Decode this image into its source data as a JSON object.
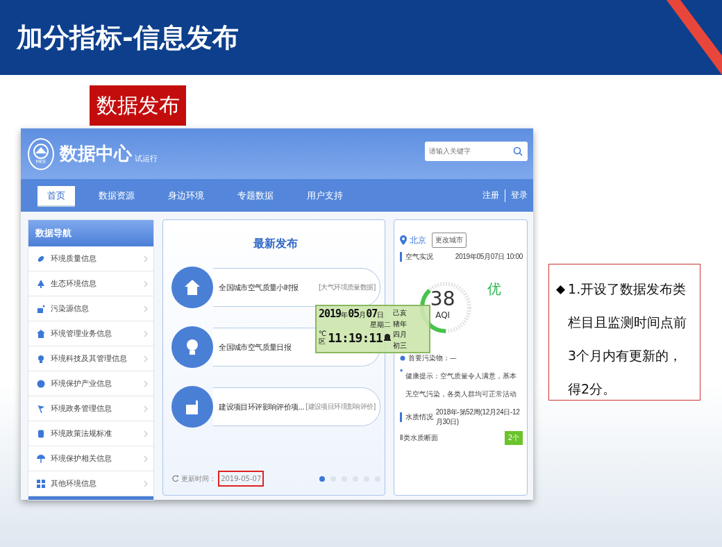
{
  "slide": {
    "title": "加分指标-信息发布",
    "section_label": "数据发布"
  },
  "site": {
    "logo_title": "数据中心",
    "logo_badge": "试运行",
    "logo_text": "MEE",
    "search": {
      "placeholder": "请输入关键字"
    },
    "nav": [
      {
        "label": "首页",
        "selected": true
      },
      {
        "label": "数据资源",
        "selected": false
      },
      {
        "label": "身边环境",
        "selected": false
      },
      {
        "label": "专题数据",
        "selected": false
      },
      {
        "label": "用户支持",
        "selected": false
      }
    ],
    "auth_links": [
      "注册",
      "登录"
    ]
  },
  "sidebar": {
    "title": "数据导航",
    "items": [
      {
        "label": "环境质量信息"
      },
      {
        "label": "生态环境信息"
      },
      {
        "label": "污染源信息"
      },
      {
        "label": "环境管理业务信息"
      },
      {
        "label": "环境科技及其管理信息"
      },
      {
        "label": "环境保护产业信息"
      },
      {
        "label": "环境政务管理信息"
      },
      {
        "label": "环境政策法规标准"
      },
      {
        "label": "环境保护相关信息"
      },
      {
        "label": "其他环境信息"
      }
    ]
  },
  "latest": {
    "title": "最新发布",
    "items": [
      {
        "title": "全国城市空气质量小时报",
        "tag": "[大气环境质量数据]"
      },
      {
        "title": "全国城市空气质量日报"
      },
      {
        "title": "建设项目环评影响评价项...",
        "tag": "[建设项目环境影响评价]"
      }
    ],
    "update_label": "更新时间：",
    "update_date": "2019-05-07",
    "update_highlighted": true,
    "pager": [
      {
        "selected": true
      },
      {
        "selected": false
      },
      {
        "selected": false
      },
      {
        "selected": false
      },
      {
        "selected": false
      },
      {
        "selected": false
      }
    ]
  },
  "air": {
    "city": "北京",
    "change_city": "更改城市",
    "section": "空气实况",
    "datetime": "2019年05月07日 10:00",
    "aqi": "38",
    "aqi_label": "AQI",
    "grade": "优",
    "level": 0.38,
    "pollutant": "首要污染物：—",
    "health": "健康提示：空气质量令人满意，基本无空气污染，各类人群均可正常活动",
    "water_section": "水质情况",
    "water_period": "2018年-第52周(12月24日-12月30日)",
    "water_item": "Ⅱ类水质断面",
    "water_count": "2个"
  },
  "clock": {
    "year": "2019",
    "year_unit": "年",
    "month": "05",
    "month_unit": "月",
    "day": "07",
    "day_unit": "日",
    "weekday": "星期二",
    "time": "11:19:11",
    "temp_unit": "℃",
    "zone": "区",
    "lunar": [
      "己亥",
      "猪年",
      "四月",
      "初三"
    ]
  },
  "callout": {
    "bullet": "◆",
    "text": "1.开设了数据发布类栏目且监测时间点前3个月内有更新的，得2分。"
  }
}
